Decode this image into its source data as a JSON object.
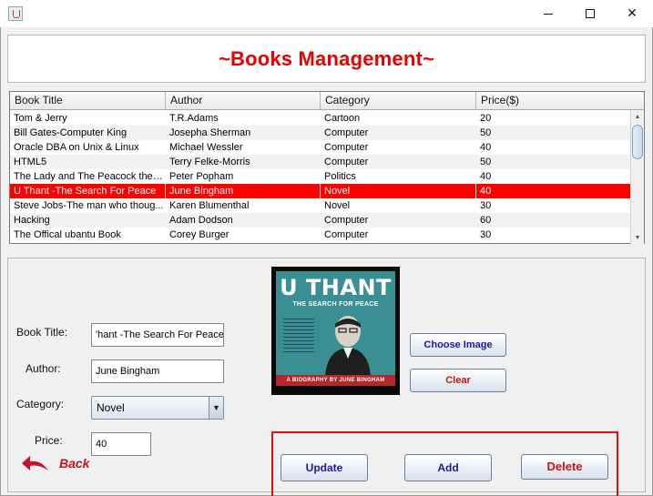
{
  "window": {
    "minimize_glyph": "minimize-icon",
    "maximize_glyph": "maximize-icon",
    "close_glyph": "✕"
  },
  "header": {
    "title": "~Books Management~"
  },
  "table": {
    "columns": [
      "Book Title",
      "Author",
      "Category",
      "Price($)"
    ],
    "rows": [
      [
        "Tom & Jerry",
        "T.R.Adams",
        "Cartoon",
        "20"
      ],
      [
        "Bill Gates-Computer King",
        "Josepha Sherman",
        "Computer",
        "50"
      ],
      [
        "Oracle DBA on Unix & Linux",
        "Michael Wessler",
        "Computer",
        "40"
      ],
      [
        "HTML5",
        "Terry Felke-Morris",
        "Computer",
        "50"
      ],
      [
        "The Lady and The Peacock the l...",
        "Peter Popham",
        "Politics",
        "40"
      ],
      [
        "U Thant -The Search For Peace",
        "June Bingham",
        "Novel",
        "40"
      ],
      [
        "Steve Jobs-The man who thoug...",
        "Karen Blumenthal",
        "Novel",
        "30"
      ],
      [
        "Hacking",
        "Adam Dodson",
        "Computer",
        "60"
      ],
      [
        "The Offical ubantu Book",
        "Corey Burger",
        "Computer",
        "30"
      ]
    ],
    "selected_row_index": 5,
    "selection_color": "#ff0000"
  },
  "form": {
    "book_title_label": "Book Title:",
    "book_title_value": "'hant -The Search For Peace",
    "author_label": "Author:",
    "author_value": "June Bingham",
    "category_label": "Category:",
    "category_value": "Novel",
    "price_label": "Price:",
    "price_value": "40"
  },
  "cover": {
    "title": "U THANT",
    "subtitle": "THE SEARCH FOR PEACE",
    "band": "A BIOGRAPHY BY JUNE BINGHAM"
  },
  "buttons": {
    "choose_image": "Choose Image",
    "clear": "Clear",
    "update": "Update",
    "add": "Add",
    "delete": "Delete"
  },
  "nav": {
    "back": "Back"
  },
  "colors": {
    "accent_red": "#e60000",
    "button_blue_text": "#1a1aa6"
  }
}
